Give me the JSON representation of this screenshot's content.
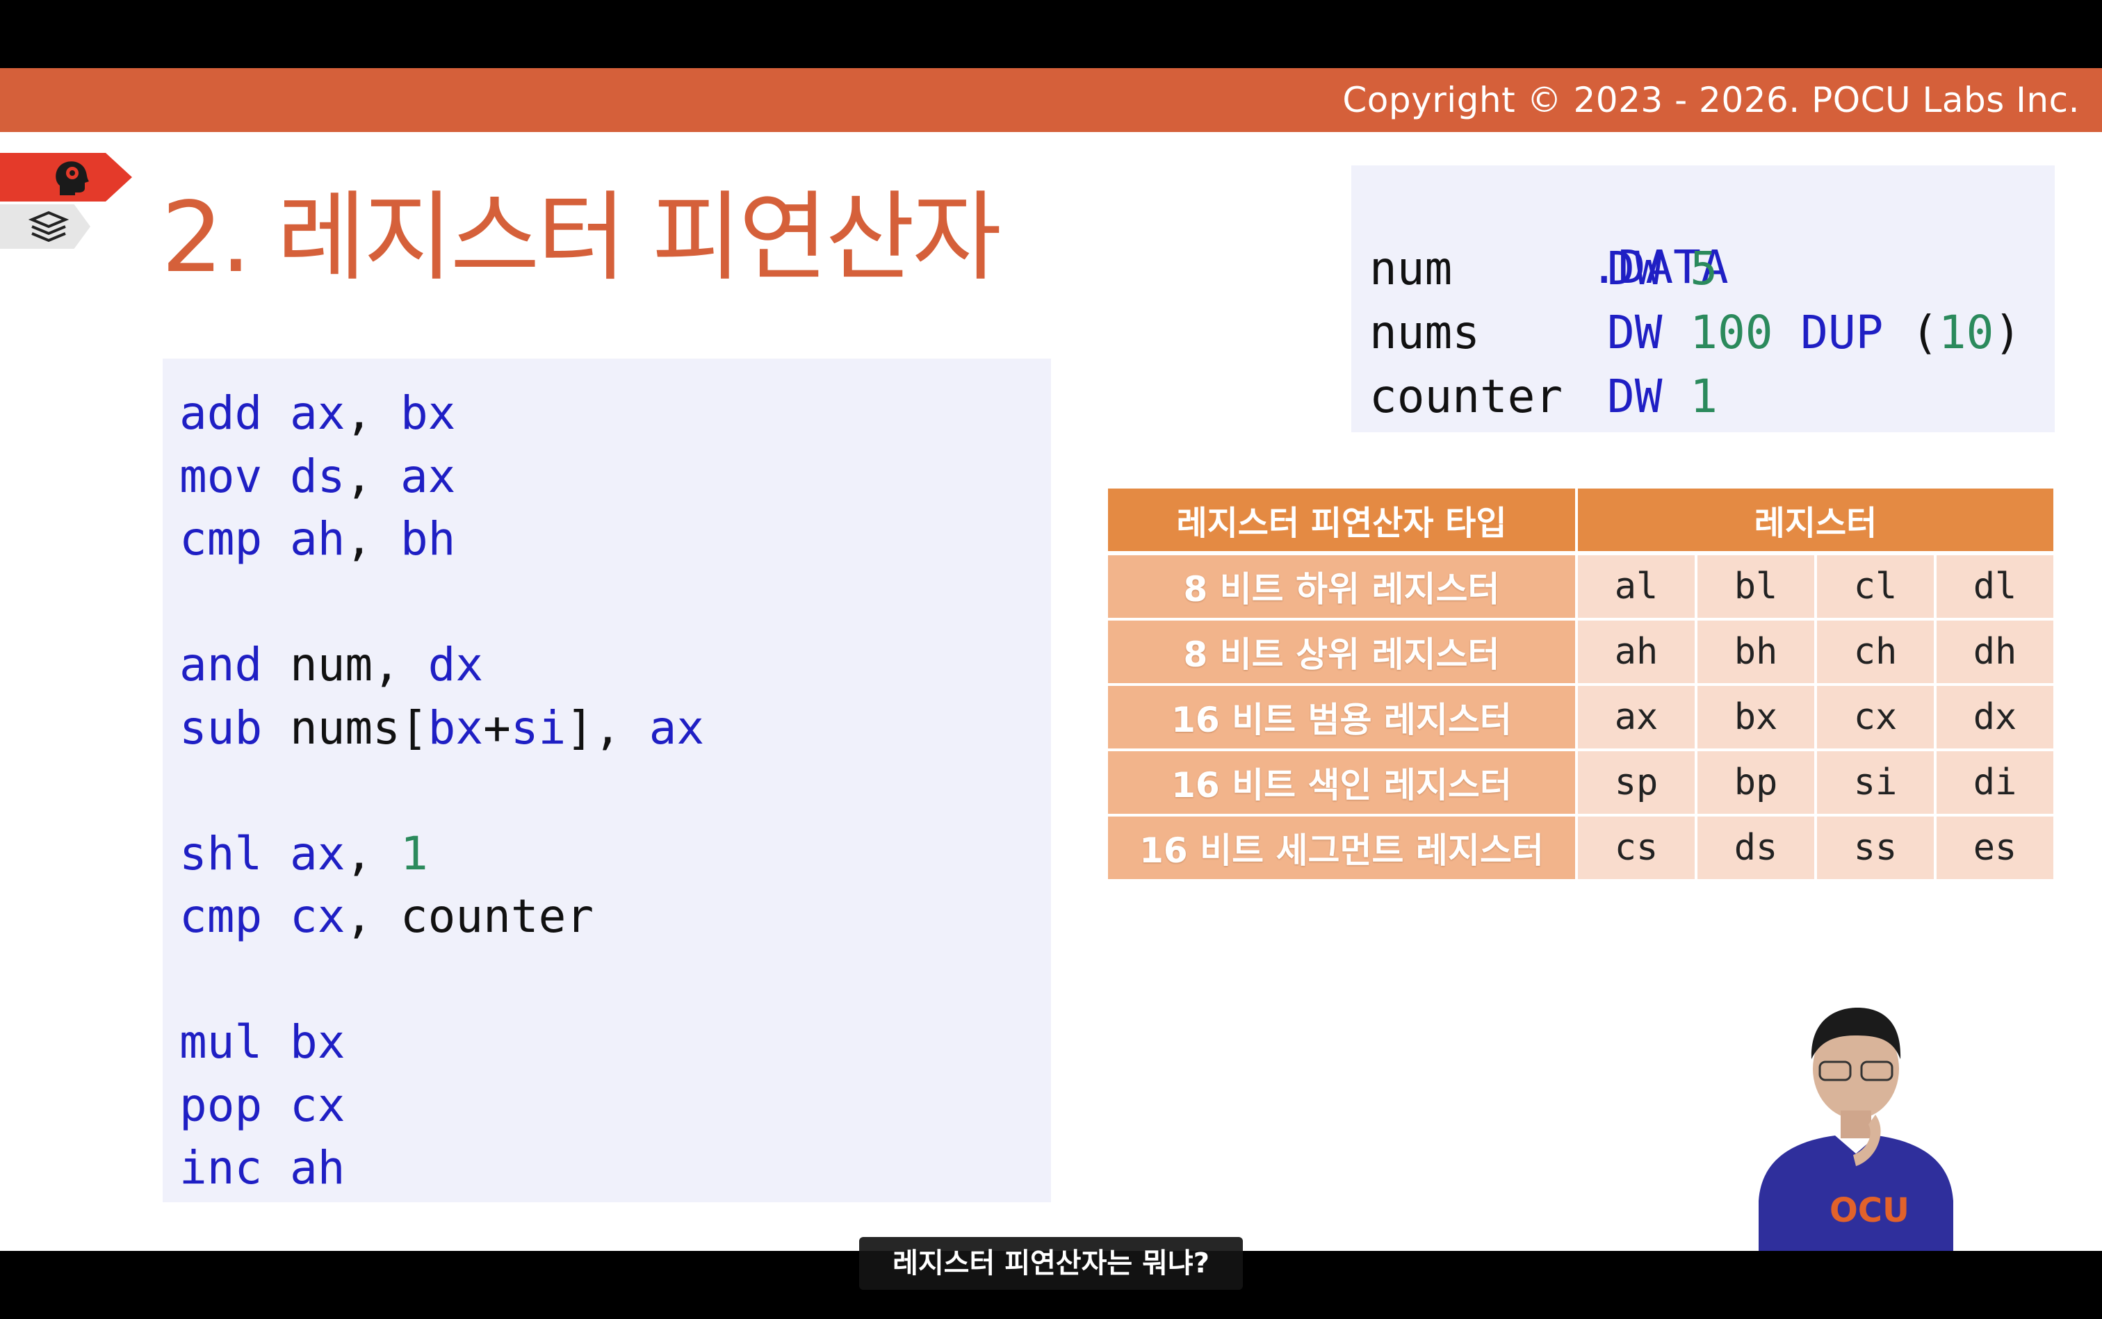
{
  "copyright": "Copyright © 2023 - 2026. POCU Labs Inc.",
  "title": "2. 레지스터 피연산자",
  "code": [
    [
      {
        "t": "add",
        "c": "kw"
      },
      {
        "t": " "
      },
      {
        "t": "ax",
        "c": "kw"
      },
      {
        "t": ", "
      },
      {
        "t": "bx",
        "c": "kw"
      }
    ],
    [
      {
        "t": "mov",
        "c": "kw"
      },
      {
        "t": " "
      },
      {
        "t": "ds",
        "c": "kw"
      },
      {
        "t": ", "
      },
      {
        "t": "ax",
        "c": "kw"
      }
    ],
    [
      {
        "t": "cmp",
        "c": "kw"
      },
      {
        "t": " "
      },
      {
        "t": "ah",
        "c": "kw"
      },
      {
        "t": ", "
      },
      {
        "t": "bh",
        "c": "kw"
      }
    ],
    [],
    [
      {
        "t": "and",
        "c": "kw"
      },
      {
        "t": " num, "
      },
      {
        "t": "dx",
        "c": "kw"
      }
    ],
    [
      {
        "t": "sub",
        "c": "kw"
      },
      {
        "t": " nums["
      },
      {
        "t": "bx",
        "c": "kw"
      },
      {
        "t": "+"
      },
      {
        "t": "si",
        "c": "kw"
      },
      {
        "t": "], "
      },
      {
        "t": "ax",
        "c": "kw"
      }
    ],
    [],
    [
      {
        "t": "shl",
        "c": "kw"
      },
      {
        "t": " "
      },
      {
        "t": "ax",
        "c": "kw"
      },
      {
        "t": ", "
      },
      {
        "t": "1",
        "c": "num"
      }
    ],
    [
      {
        "t": "cmp",
        "c": "kw"
      },
      {
        "t": " "
      },
      {
        "t": "cx",
        "c": "kw"
      },
      {
        "t": ", counter"
      }
    ],
    [],
    [
      {
        "t": "mul",
        "c": "kw"
      },
      {
        "t": " "
      },
      {
        "t": "bx",
        "c": "kw"
      }
    ],
    [
      {
        "t": "pop",
        "c": "kw"
      },
      {
        "t": " "
      },
      {
        "t": "cx",
        "c": "kw"
      }
    ],
    [
      {
        "t": "inc",
        "c": "kw"
      },
      {
        "t": " "
      },
      {
        "t": "ah",
        "c": "kw"
      }
    ]
  ],
  "data_section": {
    "header": ".DATA",
    "rows": [
      {
        "name": "num",
        "def": [
          {
            "t": "DW",
            "c": "kw"
          },
          {
            "t": " "
          },
          {
            "t": "5",
            "c": "num"
          }
        ]
      },
      {
        "name": "nums",
        "def": [
          {
            "t": "DW",
            "c": "kw"
          },
          {
            "t": " "
          },
          {
            "t": "100",
            "c": "num"
          },
          {
            "t": " "
          },
          {
            "t": "DUP",
            "c": "kw"
          },
          {
            "t": " ("
          },
          {
            "t": "10",
            "c": "num"
          },
          {
            "t": ")"
          }
        ]
      },
      {
        "name": "counter",
        "def": [
          {
            "t": "DW",
            "c": "kw"
          },
          {
            "t": " "
          },
          {
            "t": "1",
            "c": "num"
          }
        ]
      }
    ]
  },
  "register_table": {
    "headers": [
      "레지스터 피연산자 타입",
      "레지스터"
    ],
    "rows": [
      {
        "type": "8 비트 하위 레지스터",
        "regs": [
          "al",
          "bl",
          "cl",
          "dl"
        ]
      },
      {
        "type": "8 비트 상위 레지스터",
        "regs": [
          "ah",
          "bh",
          "ch",
          "dh"
        ]
      },
      {
        "type": "16 비트 범용 레지스터",
        "regs": [
          "ax",
          "bx",
          "cx",
          "dx"
        ]
      },
      {
        "type": "16 비트 색인 레지스터",
        "regs": [
          "sp",
          "bp",
          "si",
          "di"
        ]
      },
      {
        "type": "16 비트 세그먼트 레지스터",
        "regs": [
          "cs",
          "ds",
          "ss",
          "es"
        ]
      }
    ]
  },
  "subtitle": "레지스터 피연산자는 뭐냐?",
  "colors": {
    "accent": "#d5603a",
    "keyword": "#1f1fc4",
    "number": "#2b8a5c",
    "table_header": "#e48a43",
    "table_rowhead": "#f2b48b",
    "table_cell": "#f9dccd",
    "code_bg": "#f0f1fb"
  },
  "icons": [
    "brain-head-icon",
    "book-stack-icon"
  ]
}
